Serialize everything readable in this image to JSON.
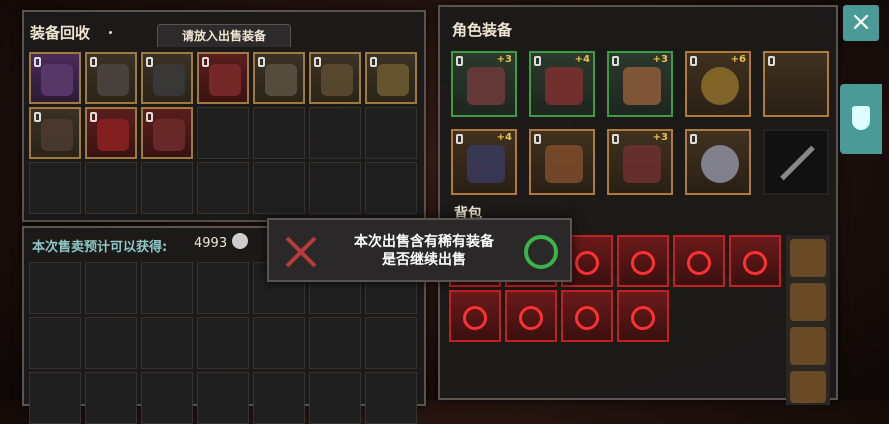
{
  "recycle": {
    "title": "装备回收",
    "tab_label": "请放入出售装备",
    "estimate_label": "本次售卖预计可以获得:",
    "estimate_value": "4993"
  },
  "equipment": {
    "title": "角色装备",
    "bag_label": "背包",
    "plus_badges": [
      "+3",
      "+4",
      "+3",
      "+6",
      "",
      "+4",
      "",
      "+3",
      "",
      ""
    ]
  },
  "dialog": {
    "line1": "本次出售含有稀有装备",
    "line2": "是否继续出售"
  },
  "colors": {
    "accent_teal": "#4a9a98",
    "confirm_green": "#3cb34a",
    "rare_red": "#c52020"
  },
  "icons": {
    "close": "×"
  }
}
